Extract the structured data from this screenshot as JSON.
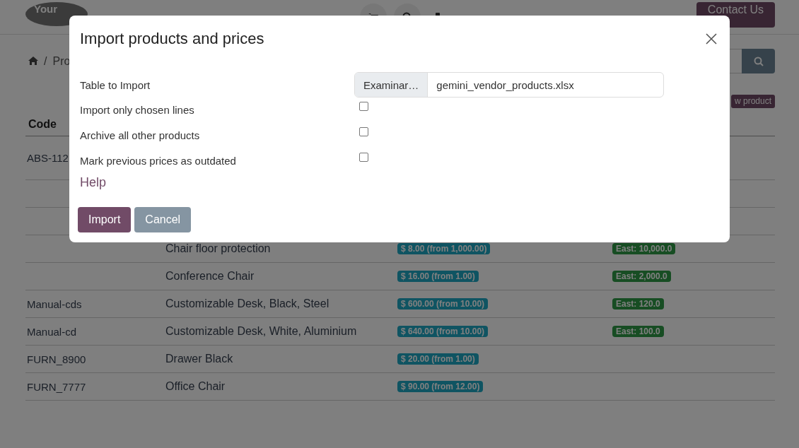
{
  "header": {
    "logo": "Your",
    "contact_button": "Contact Us"
  },
  "breadcrumb": {
    "separator": "/",
    "current": "Pro"
  },
  "new_product_button": "w product",
  "table": {
    "columns": [
      "Code"
    ],
    "rows": [
      {
        "code": "ABS-112"
      },
      {},
      {},
      {
        "name": "Chair floor protection",
        "price": "$ 8.00 (from 1,000.00)",
        "stock": "East: 10,000.0"
      },
      {
        "name": "Conference Chair",
        "price": "$ 16.00 (from 1.00)",
        "stock": "East: 2,000.0"
      },
      {
        "code": "Manual-cds",
        "name": "Customizable Desk, Black, Steel",
        "price": "$ 600.00 (from 10.00)",
        "stock": "East: 120.0"
      },
      {
        "code": "Manual-cd",
        "name": "Customizable Desk, White, Aluminium",
        "price": "$ 640.00 (from 10.00)",
        "stock": "East: 100.0"
      },
      {
        "code": "FURN_8900",
        "name": "Drawer Black",
        "price": "$ 20.00 (from 1.00)"
      },
      {
        "code": "FURN_7777",
        "name": "Office Chair",
        "price": "$ 90.00 (from 12.00)"
      }
    ]
  },
  "dialog": {
    "title": "Import products and prices",
    "file_label": "Table to Import",
    "browse_button": "Examinar…",
    "file_name": "gemini_vendor_products.xlsx",
    "options": [
      {
        "label": "Import only chosen lines",
        "checked": false
      },
      {
        "label": "Archive all other products",
        "checked": false
      },
      {
        "label": "Mark previous prices as outdated",
        "checked": false
      }
    ],
    "help": "Help",
    "buttons": [
      "Import",
      "Cancel"
    ]
  }
}
